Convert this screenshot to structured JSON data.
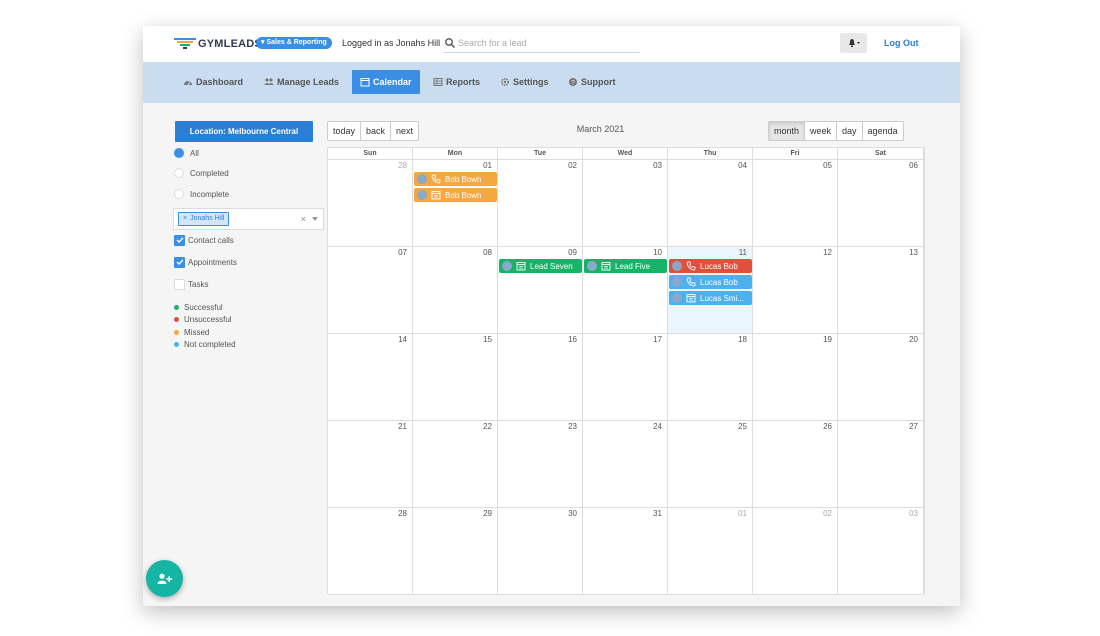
{
  "header": {
    "logo_text": "GYMLEADS",
    "badge": "▾ Sales & Reporting",
    "logged_in_text": "Logged in as Jonahs Hill",
    "search_placeholder": "Search for a lead",
    "logout_label": "Log Out"
  },
  "nav": {
    "items": [
      {
        "label": "Dashboard",
        "icon": "dashboard-icon"
      },
      {
        "label": "Manage Leads",
        "icon": "users-icon"
      },
      {
        "label": "Calendar",
        "icon": "calendar-icon",
        "active": true
      },
      {
        "label": "Reports",
        "icon": "table-icon"
      },
      {
        "label": "Settings",
        "icon": "gear-icon"
      },
      {
        "label": "Support",
        "icon": "help-icon"
      }
    ]
  },
  "sidebar": {
    "location_label": "Location: Melbourne Central",
    "filters": [
      {
        "label": "All",
        "selected": true
      },
      {
        "label": "Completed",
        "selected": false
      },
      {
        "label": "Incomplete",
        "selected": false
      }
    ],
    "user_chip": "Jonahs Hill",
    "chip_remove": "×",
    "select_clear": "×",
    "checkboxes": [
      {
        "label": "Contact calls",
        "checked": true
      },
      {
        "label": "Appointments",
        "checked": true
      },
      {
        "label": "Tasks",
        "checked": false
      }
    ],
    "legend": [
      {
        "label": "Successful",
        "color": "#16b468"
      },
      {
        "label": "Unsuccessful",
        "color": "#e0503c"
      },
      {
        "label": "Missed",
        "color": "#f5a742"
      },
      {
        "label": "Not completed",
        "color": "#4db1ee"
      }
    ]
  },
  "toolbar": {
    "nav_buttons": [
      "today",
      "back",
      "next"
    ],
    "title": "March 2021",
    "view_buttons": [
      "month",
      "week",
      "day",
      "agenda"
    ],
    "active_view": "month"
  },
  "calendar": {
    "weekdays": [
      "Sun",
      "Mon",
      "Tue",
      "Wed",
      "Thu",
      "Fri",
      "Sat"
    ],
    "weeks": [
      [
        "28",
        "01",
        "02",
        "03",
        "04",
        "05",
        "06"
      ],
      [
        "07",
        "08",
        "09",
        "10",
        "11",
        "12",
        "13"
      ],
      [
        "14",
        "15",
        "16",
        "17",
        "18",
        "19",
        "20"
      ],
      [
        "21",
        "22",
        "23",
        "24",
        "25",
        "26",
        "27"
      ],
      [
        "28",
        "29",
        "30",
        "31",
        "01",
        "02",
        "03"
      ]
    ],
    "outside_month": [
      [
        0,
        0
      ],
      [
        4,
        4
      ],
      [
        4,
        5
      ],
      [
        4,
        6
      ]
    ],
    "today": [
      1,
      4
    ],
    "events": [
      {
        "title": "Bob Bown",
        "kind": "call",
        "status": "orange",
        "week": 0,
        "day": 1,
        "slot": 0
      },
      {
        "title": "Bob Bown",
        "kind": "appointment",
        "status": "orange",
        "week": 0,
        "day": 1,
        "slot": 1
      },
      {
        "title": "Lead Seven",
        "kind": "appointment",
        "status": "green",
        "week": 1,
        "day": 2,
        "slot": 0
      },
      {
        "title": "Lead Five",
        "kind": "appointment",
        "status": "green",
        "week": 1,
        "day": 3,
        "slot": 0
      },
      {
        "title": "Lucas Bob",
        "kind": "call",
        "status": "red",
        "week": 1,
        "day": 4,
        "slot": 0
      },
      {
        "title": "Lucas Bob",
        "kind": "call",
        "status": "blue",
        "week": 1,
        "day": 4,
        "slot": 1
      },
      {
        "title": "Lucas Smi...",
        "kind": "appointment",
        "status": "blue",
        "week": 1,
        "day": 4,
        "slot": 2
      }
    ]
  },
  "fab": {
    "icon": "add-user-icon"
  }
}
